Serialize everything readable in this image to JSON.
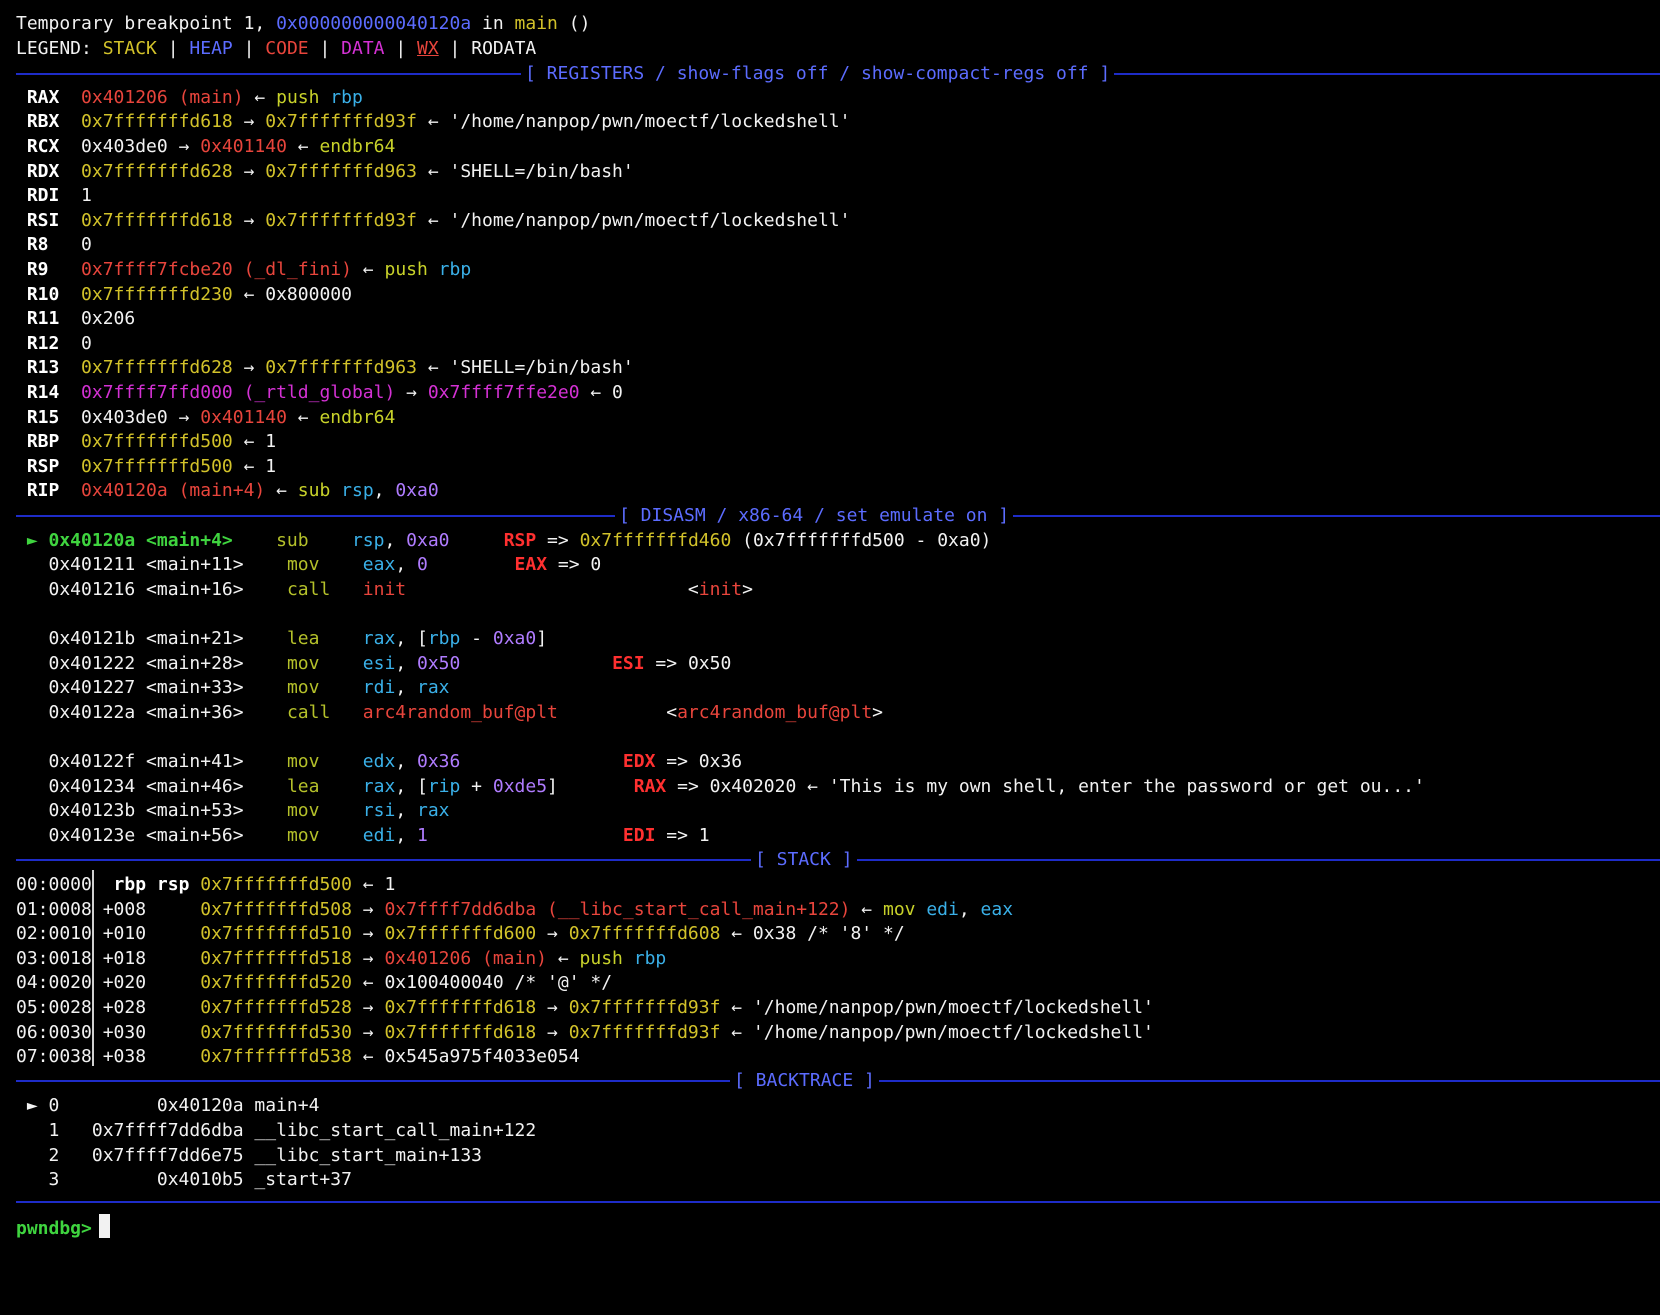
{
  "terminal": {
    "lines": [
      {
        "t": [
          [
            "W",
            "Temporary breakpoint 1, "
          ],
          [
            "B",
            "0x000000000040120a"
          ],
          [
            "W",
            " in "
          ],
          [
            "Y",
            "main"
          ],
          [
            "W",
            " ()"
          ]
        ]
      },
      {
        "t": [
          [
            "W",
            "LEGEND: "
          ],
          [
            "Y",
            "STACK"
          ],
          [
            "W",
            " | "
          ],
          [
            "B",
            "HEAP"
          ],
          [
            "W",
            " | "
          ],
          [
            "R",
            "CODE"
          ],
          [
            "W",
            " | "
          ],
          [
            "M",
            "DATA"
          ],
          [
            "W",
            " | "
          ],
          [
            "R",
            "WX"
          ],
          [
            "W",
            " | RODATA"
          ]
        ]
      },
      {
        "t": []
      },
      {
        "t": [
          [
            "WB",
            " RAX  "
          ],
          [
            "R",
            "0x401206 (main)"
          ],
          [
            "W",
            " ← "
          ],
          [
            "G",
            "push "
          ],
          [
            "C",
            "rbp"
          ]
        ]
      },
      {
        "t": [
          [
            "WB",
            " RBX  "
          ],
          [
            "Y",
            "0x7fffffffd618"
          ],
          [
            "W",
            " → "
          ],
          [
            "Y",
            "0x7fffffffd93f"
          ],
          [
            "W",
            " ← '/home/nanpop/pwn/moectf/lockedshell'"
          ]
        ]
      },
      {
        "t": [
          [
            "WB",
            " RCX  "
          ],
          [
            "W",
            "0x403de0 → "
          ],
          [
            "R",
            "0x401140"
          ],
          [
            "W",
            " ← "
          ],
          [
            "G",
            "endbr64"
          ]
        ]
      },
      {
        "t": [
          [
            "WB",
            " RDX  "
          ],
          [
            "Y",
            "0x7fffffffd628"
          ],
          [
            "W",
            " → "
          ],
          [
            "Y",
            "0x7fffffffd963"
          ],
          [
            "W",
            " ← 'SHELL=/bin/bash'"
          ]
        ]
      },
      {
        "t": [
          [
            "WB",
            " RDI  "
          ],
          [
            "W",
            "1"
          ]
        ]
      },
      {
        "t": [
          [
            "WB",
            " RSI  "
          ],
          [
            "Y",
            "0x7fffffffd618"
          ],
          [
            "W",
            " → "
          ],
          [
            "Y",
            "0x7fffffffd93f"
          ],
          [
            "W",
            " ← '/home/nanpop/pwn/moectf/lockedshell'"
          ]
        ]
      },
      {
        "t": [
          [
            "WB",
            " R8   "
          ],
          [
            "W",
            "0"
          ]
        ]
      },
      {
        "t": [
          [
            "WB",
            " R9   "
          ],
          [
            "R",
            "0x7ffff7fcbe20 (_dl_fini)"
          ],
          [
            "W",
            " ← "
          ],
          [
            "G",
            "push "
          ],
          [
            "C",
            "rbp"
          ]
        ]
      },
      {
        "t": [
          [
            "WB",
            " R10  "
          ],
          [
            "Y",
            "0x7fffffffd230"
          ],
          [
            "W",
            " ← 0x800000"
          ]
        ]
      },
      {
        "t": [
          [
            "WB",
            " R11  "
          ],
          [
            "W",
            "0x206"
          ]
        ]
      },
      {
        "t": [
          [
            "WB",
            " R12  "
          ],
          [
            "W",
            "0"
          ]
        ]
      },
      {
        "t": [
          [
            "WB",
            " R13  "
          ],
          [
            "Y",
            "0x7fffffffd628"
          ],
          [
            "W",
            " → "
          ],
          [
            "Y",
            "0x7fffffffd963"
          ],
          [
            "W",
            " ← 'SHELL=/bin/bash'"
          ]
        ]
      },
      {
        "t": [
          [
            "WB",
            " R14  "
          ],
          [
            "M",
            "0x7ffff7ffd000 (_rtld_global)"
          ],
          [
            "W",
            " → "
          ],
          [
            "M",
            "0x7ffff7ffe2e0"
          ],
          [
            "W",
            " ← 0"
          ]
        ]
      },
      {
        "t": [
          [
            "WB",
            " R15  "
          ],
          [
            "W",
            "0x403de0 → "
          ],
          [
            "R",
            "0x401140"
          ],
          [
            "W",
            " ← "
          ],
          [
            "G",
            "endbr64"
          ]
        ]
      },
      {
        "t": [
          [
            "WB",
            " RBP  "
          ],
          [
            "Y",
            "0x7fffffffd500"
          ],
          [
            "W",
            " ← 1"
          ]
        ]
      },
      {
        "t": [
          [
            "WB",
            " RSP  "
          ],
          [
            "Y",
            "0x7fffffffd500"
          ],
          [
            "W",
            " ← 1"
          ]
        ]
      },
      {
        "t": [
          [
            "WB",
            " RIP  "
          ],
          [
            "R",
            "0x40120a (main+4)"
          ],
          [
            "W",
            " ← "
          ],
          [
            "G",
            "sub "
          ],
          [
            "C",
            "rsp"
          ],
          [
            "W",
            ", "
          ],
          [
            "P",
            "0xa0"
          ]
        ]
      },
      {
        "t": []
      },
      {
        "t": [
          [
            "GR",
            " ► 0x40120a <main+4>    "
          ],
          [
            "GO",
            "sub    "
          ],
          [
            "C",
            "rsp"
          ],
          [
            "W",
            ", "
          ],
          [
            "P",
            "0xa0"
          ],
          [
            "W",
            "     "
          ],
          [
            "RB",
            "RSP"
          ],
          [
            "W",
            " => "
          ],
          [
            "Y",
            "0x7fffffffd460"
          ],
          [
            "W",
            " (0x7fffffffd500 - 0xa0)"
          ]
        ]
      },
      {
        "t": [
          [
            "W",
            "   0x401211 <main+11>    "
          ],
          [
            "GO",
            "mov    "
          ],
          [
            "C",
            "eax"
          ],
          [
            "W",
            ", "
          ],
          [
            "P",
            "0"
          ],
          [
            "W",
            "        "
          ],
          [
            "RB",
            "EAX"
          ],
          [
            "W",
            " => 0"
          ]
        ]
      },
      {
        "t": [
          [
            "W",
            "   0x401216 <main+16>    "
          ],
          [
            "GO",
            "call   "
          ],
          [
            "R",
            "init"
          ],
          [
            "W",
            "                          <"
          ],
          [
            "R",
            "init"
          ],
          [
            "W",
            ">"
          ]
        ]
      },
      {
        "t": []
      },
      {
        "t": [
          [
            "W",
            "   0x40121b <main+21>    "
          ],
          [
            "GO",
            "lea    "
          ],
          [
            "C",
            "rax"
          ],
          [
            "W",
            ", ["
          ],
          [
            "C",
            "rbp"
          ],
          [
            "W",
            " - "
          ],
          [
            "P",
            "0xa0"
          ],
          [
            "W",
            "]"
          ]
        ]
      },
      {
        "t": [
          [
            "W",
            "   0x401222 <main+28>    "
          ],
          [
            "GO",
            "mov    "
          ],
          [
            "C",
            "esi"
          ],
          [
            "W",
            ", "
          ],
          [
            "P",
            "0x50"
          ],
          [
            "W",
            "              "
          ],
          [
            "RB",
            "ESI"
          ],
          [
            "W",
            " => 0x50"
          ]
        ]
      },
      {
        "t": [
          [
            "W",
            "   0x401227 <main+33>    "
          ],
          [
            "GO",
            "mov    "
          ],
          [
            "C",
            "rdi"
          ],
          [
            "W",
            ", "
          ],
          [
            "C",
            "rax"
          ]
        ]
      },
      {
        "t": [
          [
            "W",
            "   0x40122a <main+36>    "
          ],
          [
            "GO",
            "call   "
          ],
          [
            "R",
            "arc4random_buf@plt"
          ],
          [
            "W",
            "          <"
          ],
          [
            "R",
            "arc4random_buf@plt"
          ],
          [
            "W",
            ">"
          ]
        ]
      },
      {
        "t": []
      },
      {
        "t": [
          [
            "W",
            "   0x40122f <main+41>    "
          ],
          [
            "GO",
            "mov    "
          ],
          [
            "C",
            "edx"
          ],
          [
            "W",
            ", "
          ],
          [
            "P",
            "0x36"
          ],
          [
            "W",
            "               "
          ],
          [
            "RB",
            "EDX"
          ],
          [
            "W",
            " => 0x36"
          ]
        ]
      },
      {
        "t": [
          [
            "W",
            "   0x401234 <main+46>    "
          ],
          [
            "GO",
            "lea    "
          ],
          [
            "C",
            "rax"
          ],
          [
            "W",
            ", ["
          ],
          [
            "C",
            "rip"
          ],
          [
            "W",
            " + "
          ],
          [
            "P",
            "0xde5"
          ],
          [
            "W",
            "]       "
          ],
          [
            "RB",
            "RAX"
          ],
          [
            "W",
            " => 0x402020 ← 'This is my own shell, enter the password or get ou...'"
          ]
        ]
      },
      {
        "t": [
          [
            "W",
            "   0x40123b <main+53>    "
          ],
          [
            "GO",
            "mov    "
          ],
          [
            "C",
            "rsi"
          ],
          [
            "W",
            ", "
          ],
          [
            "C",
            "rax"
          ]
        ]
      },
      {
        "t": [
          [
            "W",
            "   0x40123e <main+56>    "
          ],
          [
            "GO",
            "mov    "
          ],
          [
            "C",
            "edi"
          ],
          [
            "W",
            ", "
          ],
          [
            "P",
            "1"
          ],
          [
            "W",
            "                  "
          ],
          [
            "RB",
            "EDI"
          ],
          [
            "W",
            " => 1"
          ]
        ]
      },
      {
        "t": []
      },
      {
        "t": [
          [
            "W",
            "00:0000  "
          ],
          [
            "WB",
            "rbp rsp "
          ],
          [
            "Y",
            "0x7fffffffd500"
          ],
          [
            "W",
            " ← 1"
          ]
        ]
      },
      {
        "t": [
          [
            "W",
            "01:0008 +008     "
          ],
          [
            "Y",
            "0x7fffffffd508"
          ],
          [
            "W",
            " → "
          ],
          [
            "R",
            "0x7ffff7dd6dba (__libc_start_call_main+122)"
          ],
          [
            "W",
            " ← "
          ],
          [
            "G",
            "mov "
          ],
          [
            "C",
            "edi"
          ],
          [
            "W",
            ", "
          ],
          [
            "C",
            "eax"
          ]
        ]
      },
      {
        "t": [
          [
            "W",
            "02:0010 +010     "
          ],
          [
            "Y",
            "0x7fffffffd510"
          ],
          [
            "W",
            " → "
          ],
          [
            "Y",
            "0x7fffffffd600"
          ],
          [
            "W",
            " → "
          ],
          [
            "Y",
            "0x7fffffffd608"
          ],
          [
            "W",
            " ← 0x38 /* '8' */"
          ]
        ]
      },
      {
        "t": [
          [
            "W",
            "03:0018 +018     "
          ],
          [
            "Y",
            "0x7fffffffd518"
          ],
          [
            "W",
            " → "
          ],
          [
            "R",
            "0x401206 (main)"
          ],
          [
            "W",
            " ← "
          ],
          [
            "G",
            "push "
          ],
          [
            "C",
            "rbp"
          ]
        ]
      },
      {
        "t": [
          [
            "W",
            "04:0020 +020     "
          ],
          [
            "Y",
            "0x7fffffffd520"
          ],
          [
            "W",
            " ← 0x100400040 /* '@' */"
          ]
        ]
      },
      {
        "t": [
          [
            "W",
            "05:0028 +028     "
          ],
          [
            "Y",
            "0x7fffffffd528"
          ],
          [
            "W",
            " → "
          ],
          [
            "Y",
            "0x7fffffffd618"
          ],
          [
            "W",
            " → "
          ],
          [
            "Y",
            "0x7fffffffd93f"
          ],
          [
            "W",
            " ← '/home/nanpop/pwn/moectf/lockedshell'"
          ]
        ]
      },
      {
        "t": [
          [
            "W",
            "06:0030 +030     "
          ],
          [
            "Y",
            "0x7fffffffd530"
          ],
          [
            "W",
            " → "
          ],
          [
            "Y",
            "0x7fffffffd618"
          ],
          [
            "W",
            " → "
          ],
          [
            "Y",
            "0x7fffffffd93f"
          ],
          [
            "W",
            " ← '/home/nanpop/pwn/moectf/lockedshell'"
          ]
        ]
      },
      {
        "t": [
          [
            "W",
            "07:0038 +038     "
          ],
          [
            "Y",
            "0x7fffffffd538"
          ],
          [
            "W",
            " ← 0x545a975f4033e054"
          ]
        ]
      },
      {
        "t": []
      },
      {
        "t": [
          [
            "W",
            " ► 0         0x40120a main+4"
          ]
        ]
      },
      {
        "t": [
          [
            "W",
            "   1   0x7ffff7dd6dba __libc_start_call_main+122"
          ]
        ]
      },
      {
        "t": [
          [
            "W",
            "   2   0x7ffff7dd6e75 __libc_start_main+133"
          ]
        ]
      },
      {
        "t": [
          [
            "W",
            "   3         0x4010b5 _start+37"
          ]
        ]
      },
      {
        "t": []
      },
      {
        "t": [
          [
            "GR",
            "pwndbg> "
          ]
        ]
      }
    ],
    "section_headers": {
      "registers": "[ REGISTERS / show-flags off / show-compact-regs off ]",
      "disasm": "[ DISASM / x86-64 / set emulate on ]",
      "stack": "[ STACK ]",
      "backtrace": "[ BACKTRACE ]"
    },
    "colors": {
      "background": "#000000",
      "text": "#f2f2f2",
      "header": "#5c6cff",
      "divider": "#1e2cc8",
      "stack_yellow": "#d2c22a",
      "code_red": "#e8453c",
      "data_magenta": "#d431d4",
      "heap_blue": "#5c6cff",
      "prompt_green": "#3fd43f"
    }
  }
}
